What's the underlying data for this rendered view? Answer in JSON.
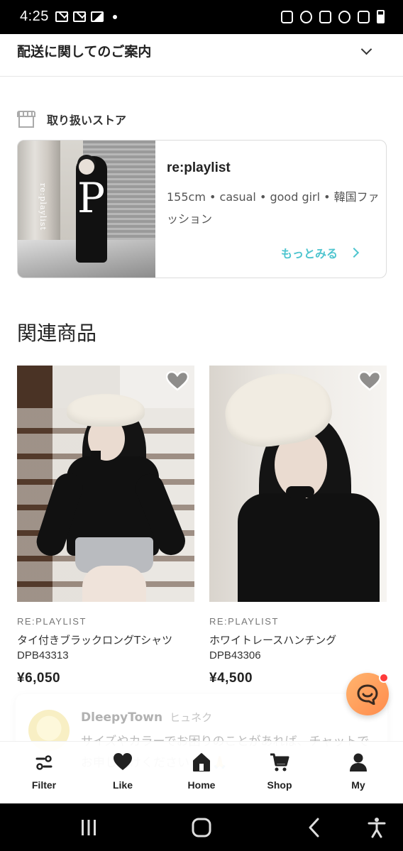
{
  "status_bar": {
    "time": "4:25"
  },
  "shipping": {
    "title": "配送に関してのご案内"
  },
  "store_section": {
    "heading": "取り扱いストア",
    "store_name": "re:playlist",
    "description": "155cm • casual • good girl • 韓国ファッション",
    "more_label": "もっとみる",
    "thumb_letter": "P",
    "thumb_script": "re:playlist"
  },
  "related": {
    "title": "関連商品",
    "products": [
      {
        "brand": "RE:PLAYLIST",
        "name": "タイ付きブラックロングTシャツ",
        "code": "DPB43313",
        "price": "¥6,050"
      },
      {
        "brand": "RE:PLAYLIST",
        "name": "ホワイトレースハンチング",
        "code": "DPB43306",
        "price": "¥4,500"
      }
    ]
  },
  "chat_popup": {
    "name": "DleepyTown",
    "subname": "ヒュネク",
    "message": "サイズやカラーでお困りのことがあれば、チャットでお申し付けください 💛 🙏"
  },
  "bottom_nav": {
    "items": [
      {
        "label": "Filter",
        "icon": "filter-icon"
      },
      {
        "label": "Like",
        "icon": "heart-icon"
      },
      {
        "label": "Home",
        "icon": "home-icon"
      },
      {
        "label": "Shop",
        "icon": "cart-icon"
      },
      {
        "label": "My",
        "icon": "person-icon"
      }
    ]
  },
  "colors": {
    "accent": "#4fc5cf",
    "chat_button": "#ff9a55",
    "badge": "#ff3b3b"
  }
}
